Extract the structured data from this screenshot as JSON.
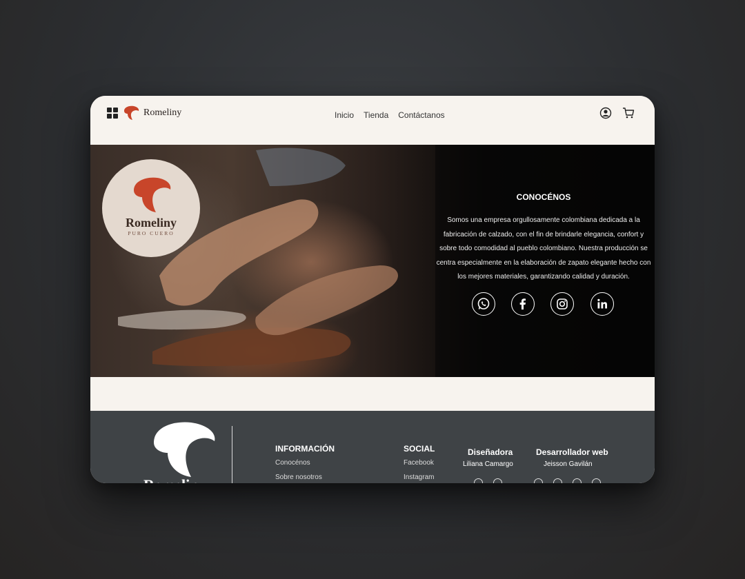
{
  "header": {
    "brand": "Romeliny",
    "nav": [
      "Inicio",
      "Tienda",
      "Contáctanos"
    ]
  },
  "hero": {
    "badge_name": "Romeliny",
    "badge_sub": "PURO CUERO",
    "title": "CONOCÉNOS",
    "text": "Somos una empresa orgullosamente colombiana dedicada a la fabricación de calzado, con el fin de brindarle elegancia, confort y sobre todo comodidad al pueblo colombiano. Nuestra producción se centra especialmente en la elaboración de zapato elegante hecho con los mejores materiales, garantizando calidad y duración.",
    "social_icons": [
      "whatsapp-icon",
      "facebook-icon",
      "instagram-icon",
      "linkedin-icon"
    ]
  },
  "footer": {
    "logo_text": "Romeliny",
    "info": {
      "title": "INFORMACIÓN",
      "links": [
        "Conocénos",
        "Sobre nosotros"
      ]
    },
    "social": {
      "title": "SOCIAL",
      "links": [
        "Facebook",
        "Instagram"
      ]
    },
    "designer": {
      "title": "Diseñadora",
      "name": "Liliana Camargo"
    },
    "developer": {
      "title": "Desarrollador web",
      "name": "Jeisson Gavilán"
    }
  },
  "colors": {
    "brand_red": "#c8452a",
    "footer_bg": "#3f4346",
    "page_bg": "#f7f3ee"
  }
}
